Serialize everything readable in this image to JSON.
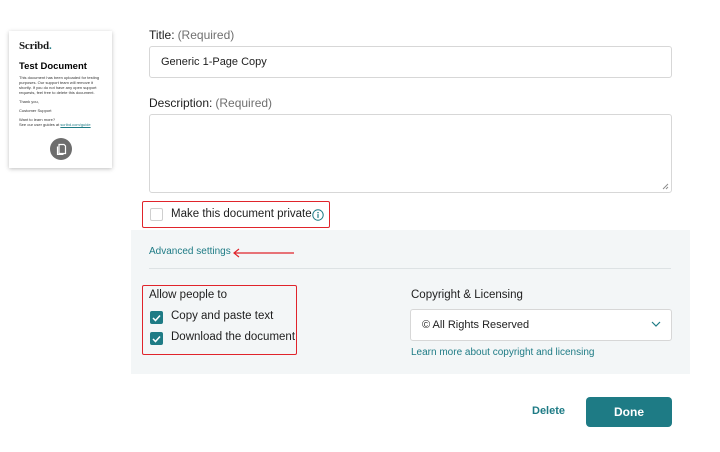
{
  "thumbnail": {
    "logo": "Scribd",
    "logo_dot": ".",
    "doc_title": "Test Document",
    "body_lines": [
      "This document has been uploaded for testing purposes. Our support team will remove it shortly. If you do not have any open support requests, feel free to delete this document.",
      "Thank you,",
      "Customer Support",
      "Want to learn more?"
    ],
    "guides_prefix": "See our user guides at",
    "guides_link": "scribd.com/guide",
    "copy_icon": "copy-icon"
  },
  "form": {
    "title_label": "Title:",
    "title_required": "(Required)",
    "title_value": "Generic 1-Page Copy",
    "description_label": "Description:",
    "description_required": "(Required)",
    "description_value": "",
    "private_label": "Make this document private",
    "private_checked": false,
    "info_icon": "info-icon"
  },
  "advanced": {
    "link_label": "Advanced settings",
    "allow_heading": "Allow people to",
    "options": [
      {
        "label": "Copy and paste text",
        "checked": true
      },
      {
        "label": "Download the document",
        "checked": true
      }
    ],
    "copyright_heading": "Copyright & Licensing",
    "license_value": "© All Rights Reserved",
    "learn_more_link": "Learn more about copyright and licensing"
  },
  "actions": {
    "delete_label": "Delete",
    "done_label": "Done"
  },
  "colors": {
    "accent": "#1e7b85",
    "annotation_red": "#e0242b",
    "panel_bg": "#f3f6f7"
  }
}
